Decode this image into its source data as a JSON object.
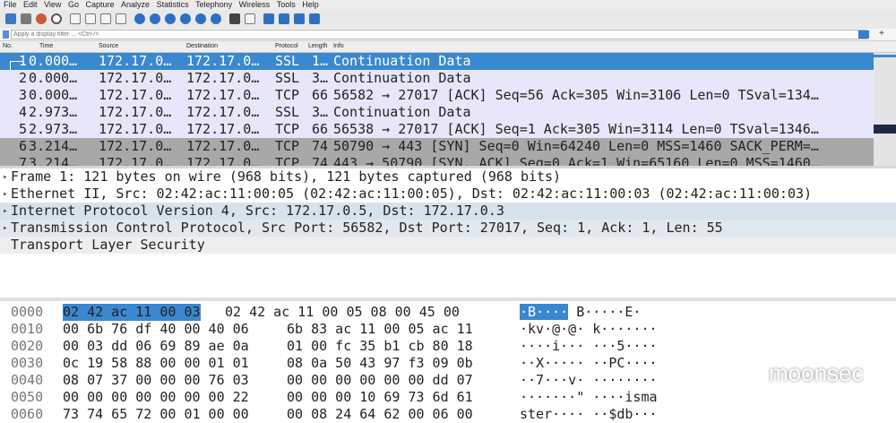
{
  "menu": [
    "File",
    "Edit",
    "View",
    "Go",
    "Capture",
    "Analyze",
    "Statistics",
    "Telephony",
    "Wireless",
    "Tools",
    "Help"
  ],
  "filter": {
    "placeholder": "Apply a display filter ... <Ctrl-/>",
    "plus": "+"
  },
  "columns": {
    "no": "No.",
    "time": "Time",
    "source": "Source",
    "destination": "Destination",
    "protocol": "Protocol",
    "length": "Length",
    "info": "Info"
  },
  "packets": [
    {
      "no": "1",
      "time": "0.000…",
      "src": "172.17.0…",
      "dst": "172.17.0…",
      "proto": "SSL",
      "len": "1…",
      "info": "Continuation Data"
    },
    {
      "no": "2",
      "time": "0.000…",
      "src": "172.17.0…",
      "dst": "172.17.0…",
      "proto": "SSL",
      "len": "3…",
      "info": "Continuation Data"
    },
    {
      "no": "3",
      "time": "0.000…",
      "src": "172.17.0…",
      "dst": "172.17.0…",
      "proto": "TCP",
      "len": "66",
      "info": "56582 → 27017 [ACK] Seq=56 Ack=305 Win=3106 Len=0 TSval=134…"
    },
    {
      "no": "4",
      "time": "2.973…",
      "src": "172.17.0…",
      "dst": "172.17.0…",
      "proto": "SSL",
      "len": "3…",
      "info": "Continuation Data"
    },
    {
      "no": "5",
      "time": "2.973…",
      "src": "172.17.0…",
      "dst": "172.17.0…",
      "proto": "TCP",
      "len": "66",
      "info": "56538 → 27017 [ACK] Seq=1 Ack=305 Win=3114 Len=0 TSval=1346…"
    },
    {
      "no": "6",
      "time": "3.214…",
      "src": "172.17.0…",
      "dst": "172.17.0…",
      "proto": "TCP",
      "len": "74",
      "info": "50790 → 443 [SYN] Seq=0 Win=64240 Len=0 MSS=1460 SACK_PERM=…"
    },
    {
      "no": "7",
      "time": "3.214…",
      "src": "172.17.0…",
      "dst": "172.17.0…",
      "proto": "TCP",
      "len": "74",
      "info": "443 → 50790 [SYN, ACK] Seq=0 Ack=1 Win=65160 Len=0 MSS=1460…"
    }
  ],
  "details": [
    "Frame 1: 121 bytes on wire (968 bits), 121 bytes captured (968 bits)",
    "Ethernet II, Src: 02:42:ac:11:00:05 (02:42:ac:11:00:05), Dst: 02:42:ac:11:00:03 (02:42:ac:11:00:03)",
    "Internet Protocol Version 4, Src: 172.17.0.5, Dst: 172.17.0.3",
    "Transmission Control Protocol, Src Port: 56582, Dst Port: 27017, Seq: 1, Ack: 1, Len: 55",
    "Transport Layer Security"
  ],
  "hex": [
    {
      "off": "0000",
      "sel": "02 42 ac 11 00 03",
      "b1": "",
      "b2": "02 42  ac 11 00 05 08 00 45 00",
      "asel": "·B····",
      "ascii": " B·····E·"
    },
    {
      "off": "0010",
      "sel": "",
      "b1": "00 6b 76 df 40 00 40 06",
      "b2": "6b 83 ac 11 00 05 ac 11",
      "asel": "",
      "ascii": "·kv·@·@· k·······"
    },
    {
      "off": "0020",
      "sel": "",
      "b1": "00 03 dd 06 69 89 ae 0a",
      "b2": "01 00 fc 35 b1 cb 80 18",
      "asel": "",
      "ascii": "····i··· ···5····"
    },
    {
      "off": "0030",
      "sel": "",
      "b1": "0c 19 58 88 00 00 01 01",
      "b2": "08 0a 50 43 97 f3 09 0b",
      "asel": "",
      "ascii": "··X····· ··PC····"
    },
    {
      "off": "0040",
      "sel": "",
      "b1": "08 07 37 00 00 00 76 03",
      "b2": "00 00 00 00 00 00 dd 07",
      "asel": "",
      "ascii": "··7···v· ········"
    },
    {
      "off": "0050",
      "sel": "",
      "b1": "00 00 00 00 00 00 00 22",
      "b2": "00 00 00 10 69 73 6d 61",
      "asel": "",
      "ascii": "·······\" ····isma"
    },
    {
      "off": "0060",
      "sel": "",
      "b1": "73 74 65 72 00 01 00 00",
      "b2": "00 08 24 64 62 00 06 00",
      "asel": "",
      "ascii": "ster···· ··$db···"
    }
  ],
  "watermark": "moonsec",
  "colors": {
    "selected": "#3a88cf",
    "tcp_row": "#e8e6fa",
    "syn_row": "#a8a8a8"
  }
}
